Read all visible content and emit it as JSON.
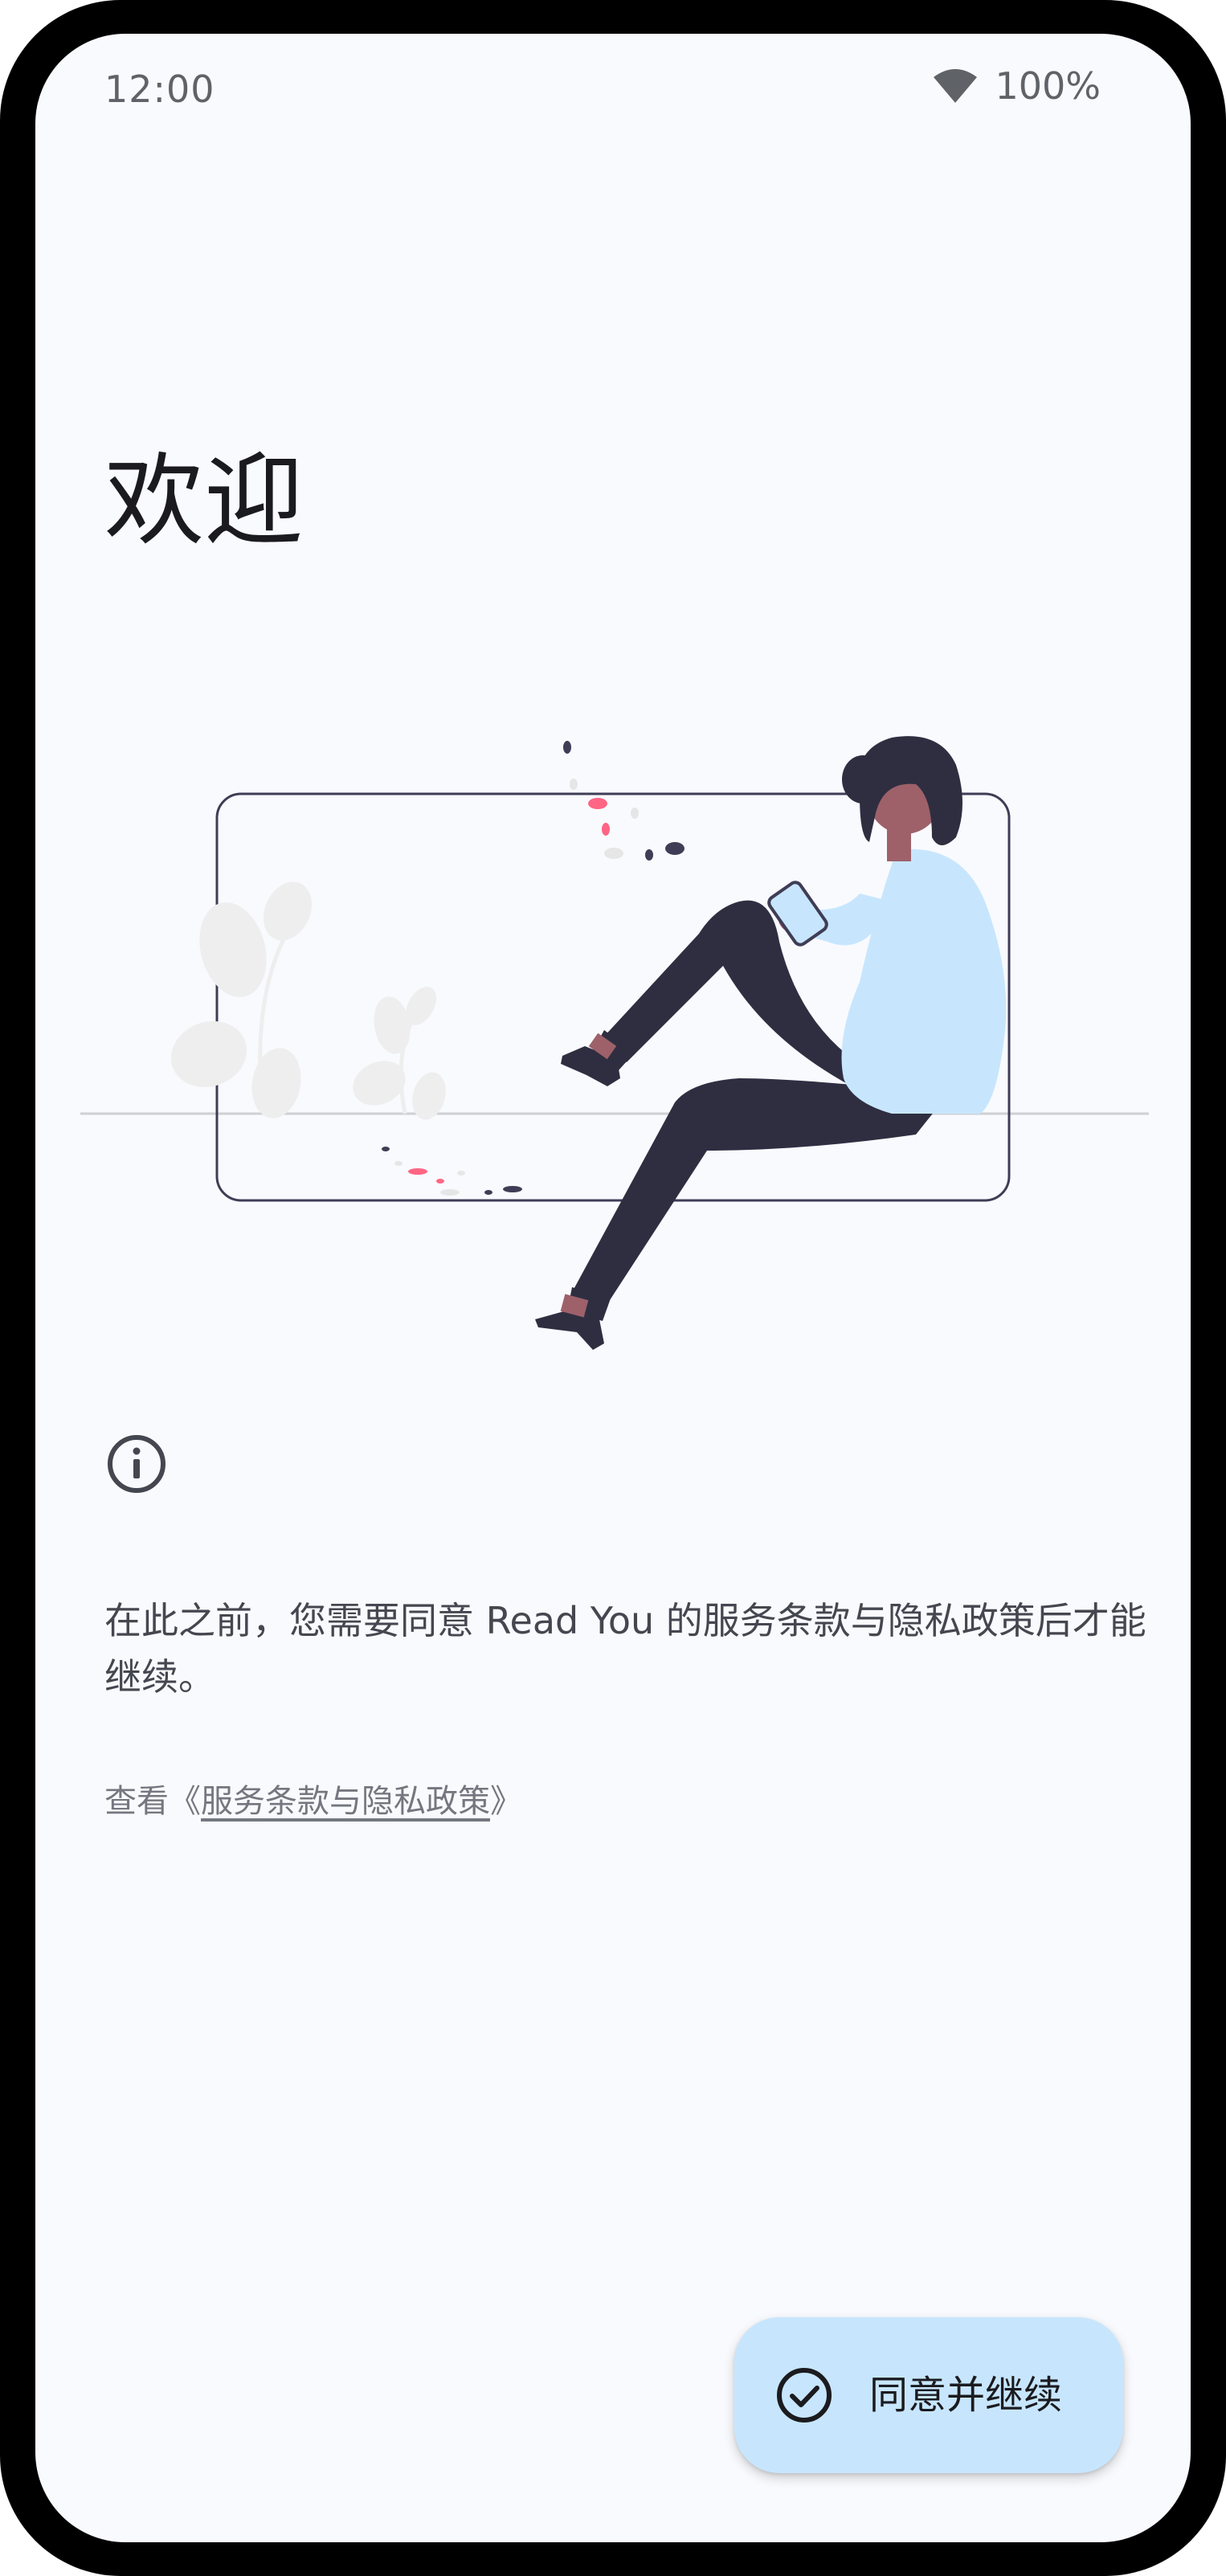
{
  "status_bar": {
    "time": "12:00",
    "battery": "100%",
    "wifi_icon": "wifi-icon"
  },
  "welcome": {
    "title": "欢迎"
  },
  "illustration": {
    "icon": "person-reading-illustration"
  },
  "info": {
    "icon": "info-icon",
    "notice": "在此之前，您需要同意 Read You 的服务条款与隐私政策后才能继续。",
    "view_prefix": "查看《",
    "policy_link": "服务条款与隐私政策",
    "view_suffix": "》"
  },
  "fab": {
    "icon": "check-circle-icon",
    "label": "同意并继续"
  },
  "colors": {
    "background": "#f9fafe",
    "fab_container": "#c7e6fd",
    "accent_pink": "#ff6584",
    "dark_figure": "#2f2e41",
    "shirt_blue": "#c7e6fd"
  }
}
